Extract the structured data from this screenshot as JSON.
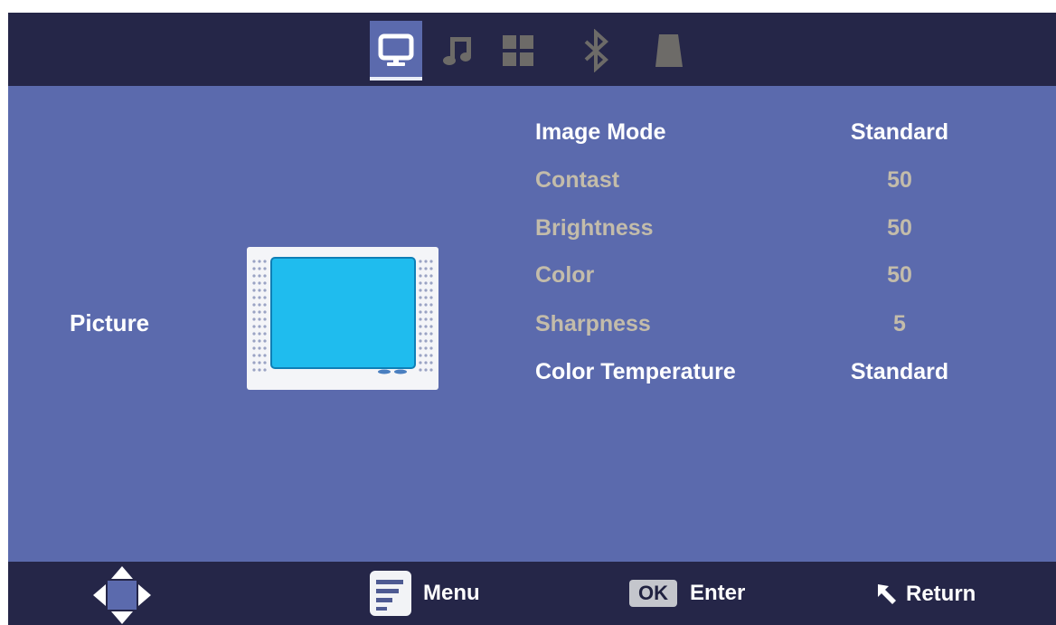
{
  "top_tabs": [
    {
      "icon": "monitor-icon",
      "active": true
    },
    {
      "icon": "music-note-icon",
      "active": false
    },
    {
      "icon": "grid-icon",
      "active": false
    },
    {
      "icon": "bluetooth-icon",
      "active": false
    },
    {
      "icon": "lock-icon",
      "active": false
    }
  ],
  "section": {
    "title": "Picture",
    "illustration": "tv-screen-icon"
  },
  "settings": [
    {
      "label": "Image Mode",
      "value": "Standard",
      "enabled": true
    },
    {
      "label": "Contast",
      "value": "50",
      "enabled": false
    },
    {
      "label": "Brightness",
      "value": "50",
      "enabled": false
    },
    {
      "label": "Color",
      "value": "50",
      "enabled": false
    },
    {
      "label": "Sharpness",
      "value": "5",
      "enabled": false
    },
    {
      "label": "Color Temperature",
      "value": "Standard",
      "enabled": true
    }
  ],
  "footer": {
    "nav_icon": "direction-pad-icon",
    "menu_label": "Menu",
    "ok_badge": "OK",
    "enter_label": "Enter",
    "return_label": "Return"
  },
  "colors": {
    "panel": "#5b6aad",
    "bar": "#252648",
    "enabled_text": "#ffffff",
    "disabled_text": "#c3bcaa",
    "screen": "#1fbcee"
  }
}
